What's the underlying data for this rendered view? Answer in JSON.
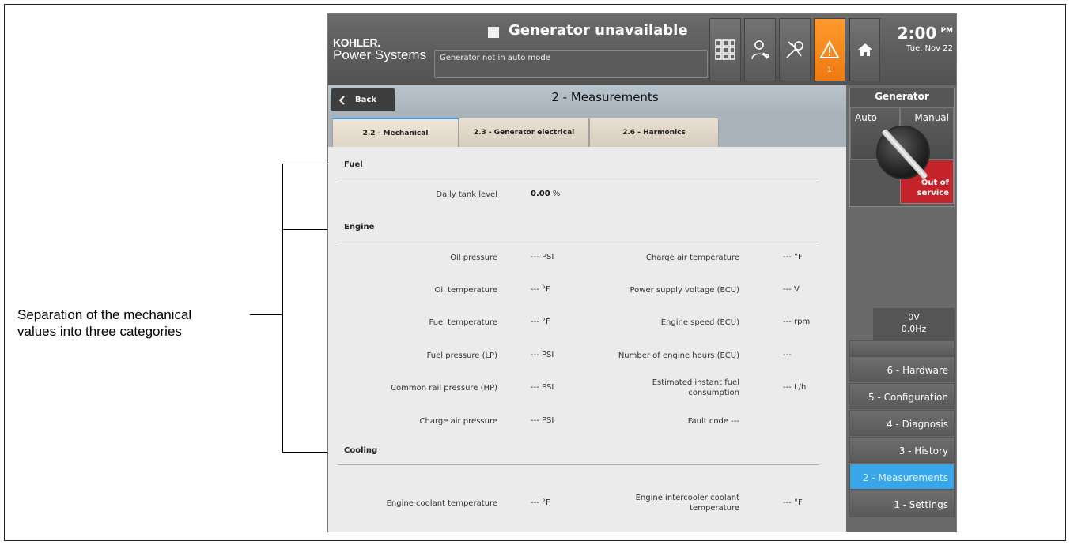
{
  "annotation": {
    "line1": "Separation of the mechanical",
    "line2": "values into three categories"
  },
  "topbar": {
    "brand_line1": "KOHLER.",
    "brand_line2": "Power Systems",
    "status_title": "Generator unavailable",
    "status_message": "Generator not in auto mode",
    "alert_count": "1",
    "clock_time": "2:00",
    "clock_ampm": "PM",
    "clock_date": "Tue, Nov 22",
    "icons": [
      "keypad-icon",
      "operator-icon",
      "maintenance-icon",
      "warning-icon",
      "home-icon"
    ],
    "alert_color": "#f58a1c"
  },
  "header": {
    "back_label": "Back",
    "page_title": "2 - Measurements"
  },
  "tabs": [
    {
      "label": "2.2 - Mechanical",
      "active": true
    },
    {
      "label": "2.3 - Generator electrical",
      "active": false
    },
    {
      "label": "2.6 - Harmonics",
      "active": false
    }
  ],
  "sections": {
    "fuel": {
      "title": "Fuel",
      "rows": [
        {
          "label": "Daily tank level",
          "value": "0.00",
          "unit": "%"
        }
      ]
    },
    "engine": {
      "title": "Engine",
      "left": [
        {
          "label": "Oil pressure",
          "value": "---",
          "unit": "PSI"
        },
        {
          "label": "Oil temperature",
          "value": "---",
          "unit": "°F"
        },
        {
          "label": "Fuel temperature",
          "value": "---",
          "unit": "°F"
        },
        {
          "label": "Fuel pressure (LP)",
          "value": "---",
          "unit": "PSI"
        },
        {
          "label": "Common rail pressure (HP)",
          "value": "---",
          "unit": "PSI"
        },
        {
          "label": "Charge air pressure",
          "value": "---",
          "unit": "PSI"
        }
      ],
      "right": [
        {
          "label": "Charge air temperature",
          "value": "---",
          "unit": "°F"
        },
        {
          "label": "Power supply voltage (ECU)",
          "value": "---",
          "unit": "V"
        },
        {
          "label": "Engine speed (ECU)",
          "value": "---",
          "unit": "rpm"
        },
        {
          "label": "Number of engine hours (ECU)",
          "value": "---",
          "unit": ""
        },
        {
          "label": "Estimated instant fuel consumption",
          "value": "---",
          "unit": "L/h"
        },
        {
          "label": "Fault code",
          "value": "---",
          "unit": ""
        }
      ]
    },
    "cooling": {
      "title": "Cooling",
      "left": [
        {
          "label": "Engine coolant temperature",
          "value": "---",
          "unit": "°F"
        }
      ],
      "right": [
        {
          "label": "Engine intercooler coolant temperature",
          "value": "---",
          "unit": "°F"
        }
      ]
    }
  },
  "side": {
    "generator_title": "Generator",
    "mode_auto": "Auto",
    "mode_manual": "Manual",
    "mode_out_of_service": "Out of service",
    "oos_color": "#c4232a",
    "voltage": "0V",
    "frequency": "0.0Hz",
    "menu": [
      {
        "label": "6 - Hardware",
        "active": false
      },
      {
        "label": "5 - Configuration",
        "active": false
      },
      {
        "label": "4 - Diagnosis",
        "active": false
      },
      {
        "label": "3 - History",
        "active": false
      },
      {
        "label": "2 - Measurements",
        "active": true
      },
      {
        "label": "1 - Settings",
        "active": false
      }
    ],
    "active_color": "#3aa6ea"
  }
}
